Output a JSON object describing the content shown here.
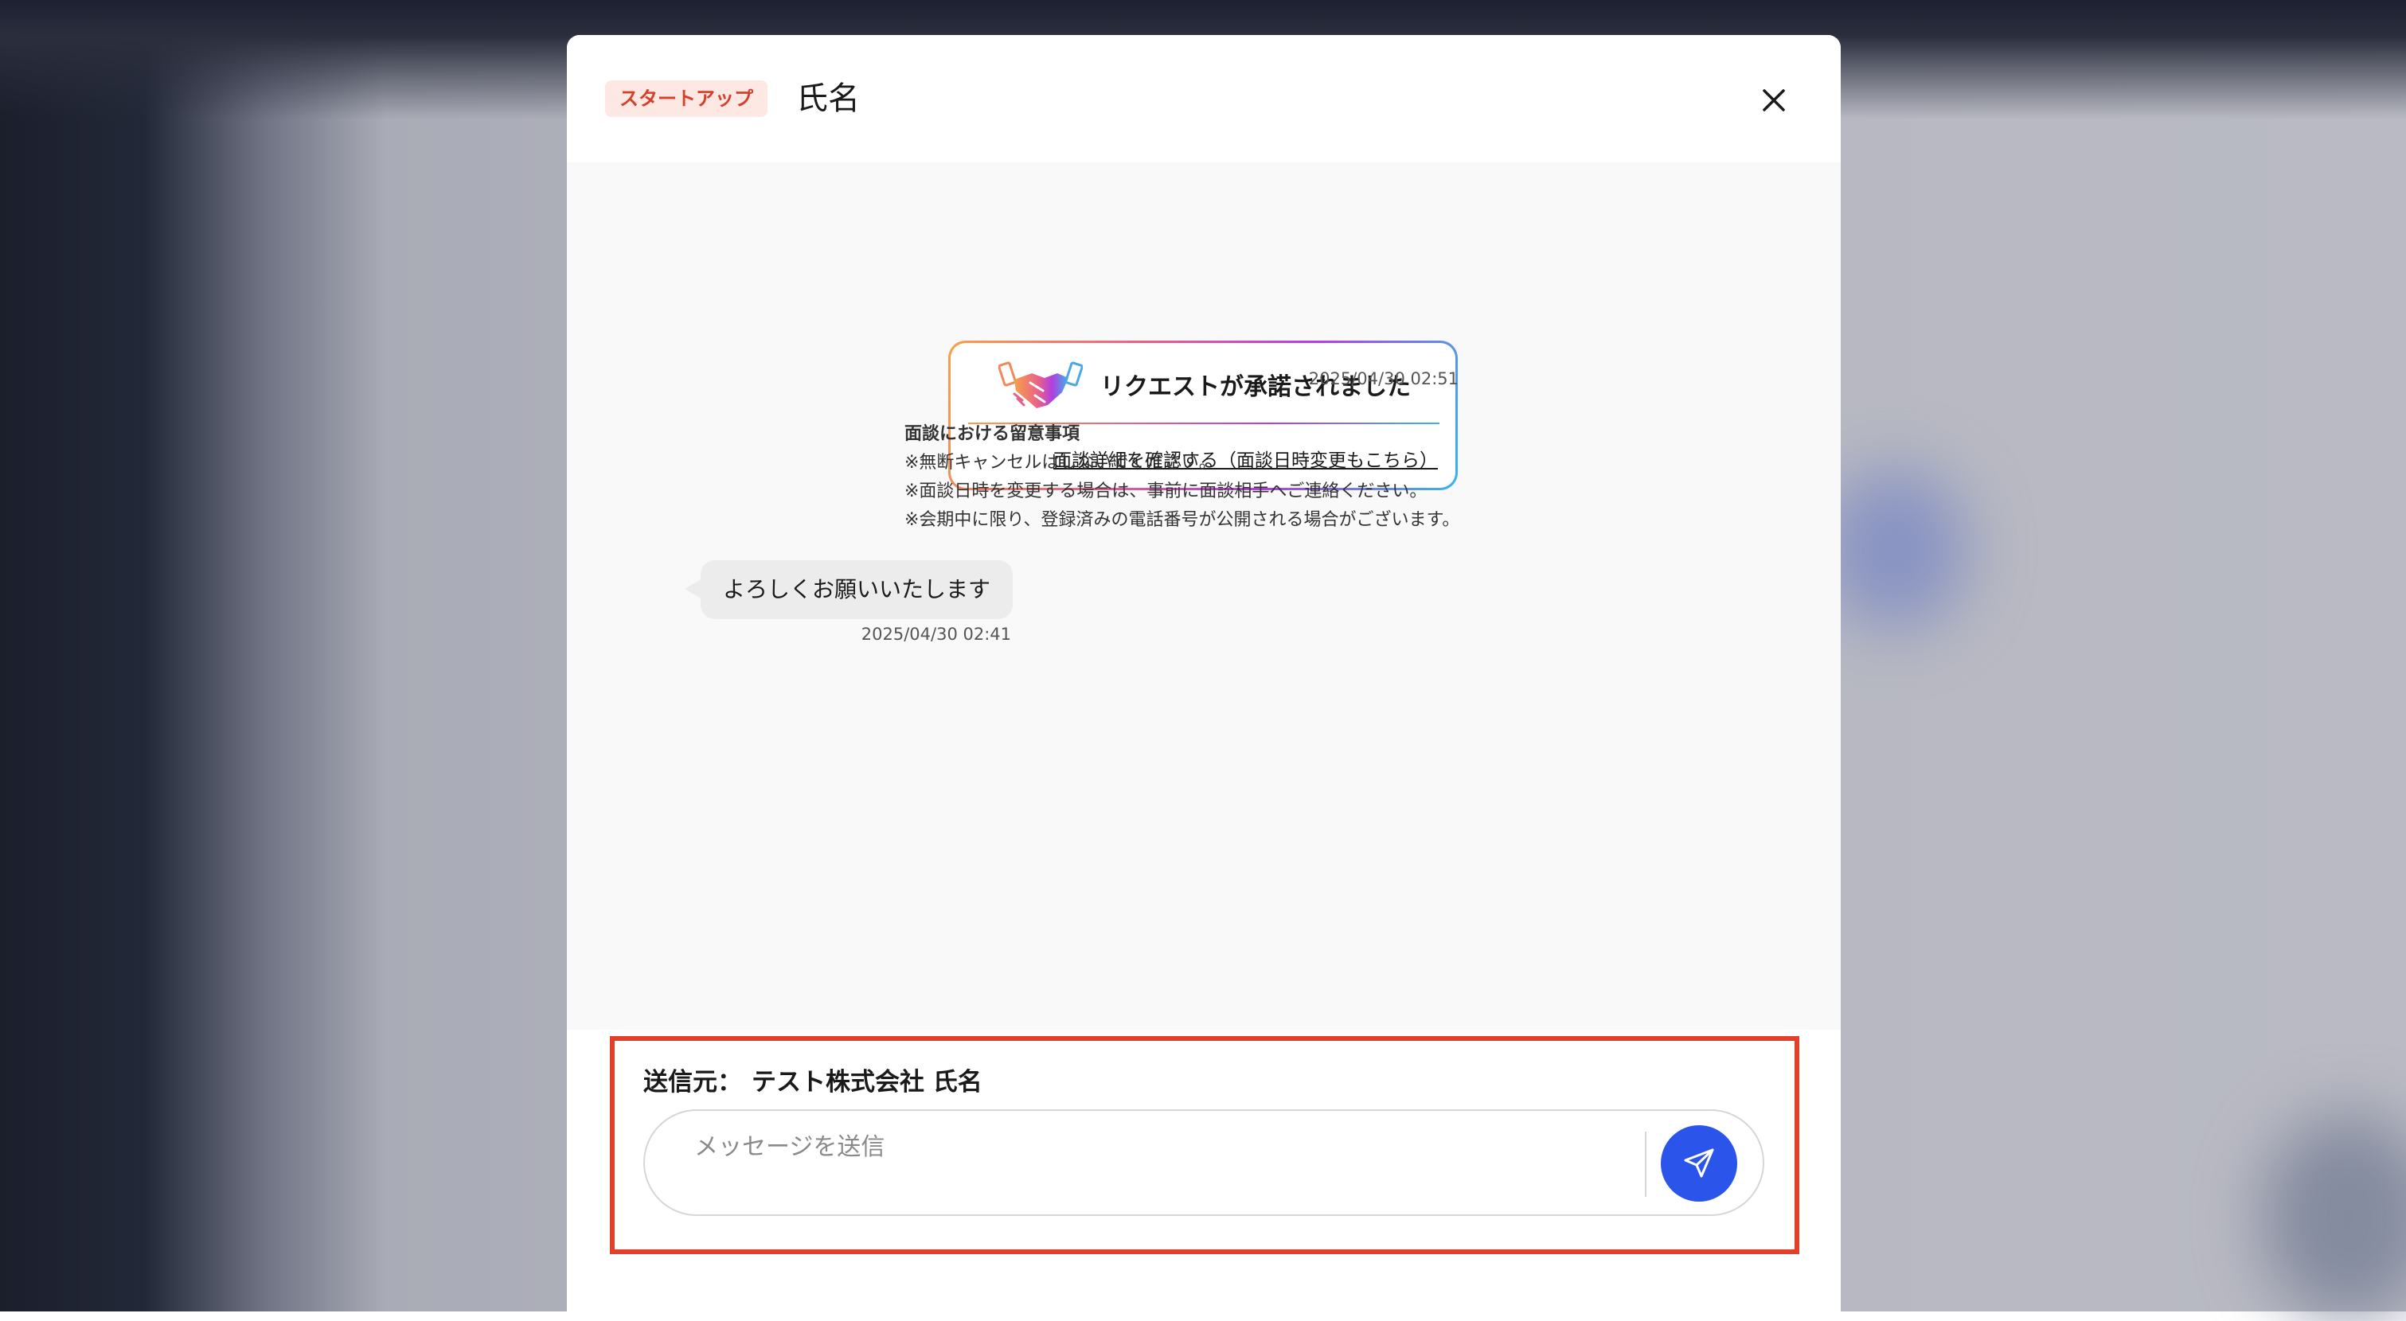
{
  "header": {
    "badge": "スタートアップ",
    "title": "氏名"
  },
  "accept_card": {
    "title": "リクエストが承諾されました",
    "link": "面談詳細を確認する（面談日時変更もこちら）",
    "timestamp": "2025/04/30 02:51"
  },
  "notes": {
    "title": "面談における留意事項",
    "items": [
      "※無断キャンセルはしないでください。",
      "※面談日時を変更する場合は、事前に面談相手へご連絡ください。",
      "※会期中に限り、登録済みの電話番号が公開される場合がございます。"
    ]
  },
  "message": {
    "text": "よろしくお願いいたします",
    "timestamp": "2025/04/30 02:41"
  },
  "compose": {
    "sender_label": "送信元：",
    "sender_name": "テスト株式会社 氏名",
    "placeholder": "メッセージを送信"
  },
  "colors": {
    "badge_text": "#d6402a",
    "badge_bg": "#fde8e4",
    "send_button": "#2a54ea",
    "highlight": "#e2402a"
  },
  "icons": [
    "close-icon",
    "handshake-icon",
    "send-icon"
  ]
}
